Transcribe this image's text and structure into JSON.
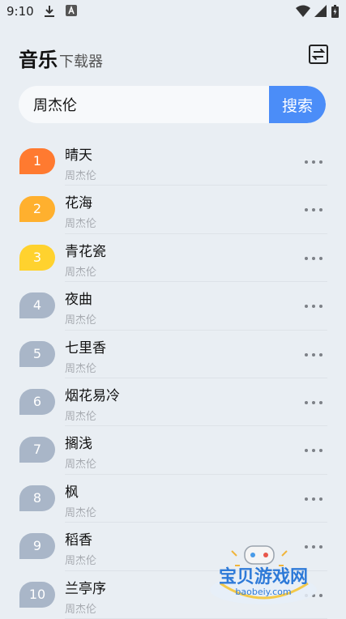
{
  "status_bar": {
    "time": "9:10"
  },
  "header": {
    "title_main": "音乐",
    "title_sub": "下载器"
  },
  "search": {
    "value": "周杰伦",
    "button_label": "搜索"
  },
  "colors": {
    "rank_1": "#ff7a30",
    "rank_2": "#ffb02e",
    "rank_3": "#ffd22e",
    "rank_other": "#a9b6c8",
    "accent": "#4b8df8"
  },
  "songs": [
    {
      "rank": "1",
      "title": "晴天",
      "artist": "周杰伦"
    },
    {
      "rank": "2",
      "title": "花海",
      "artist": "周杰伦"
    },
    {
      "rank": "3",
      "title": "青花瓷",
      "artist": "周杰伦"
    },
    {
      "rank": "4",
      "title": "夜曲",
      "artist": "周杰伦"
    },
    {
      "rank": "5",
      "title": "七里香",
      "artist": "周杰伦"
    },
    {
      "rank": "6",
      "title": "烟花易冷",
      "artist": "周杰伦"
    },
    {
      "rank": "7",
      "title": "搁浅",
      "artist": "周杰伦"
    },
    {
      "rank": "8",
      "title": "枫",
      "artist": "周杰伦"
    },
    {
      "rank": "9",
      "title": "稻香",
      "artist": "周杰伦"
    },
    {
      "rank": "10",
      "title": "兰亭序",
      "artist": "周杰伦"
    }
  ],
  "watermark": {
    "text": "宝贝游戏网",
    "url": "baobeiy.com"
  }
}
